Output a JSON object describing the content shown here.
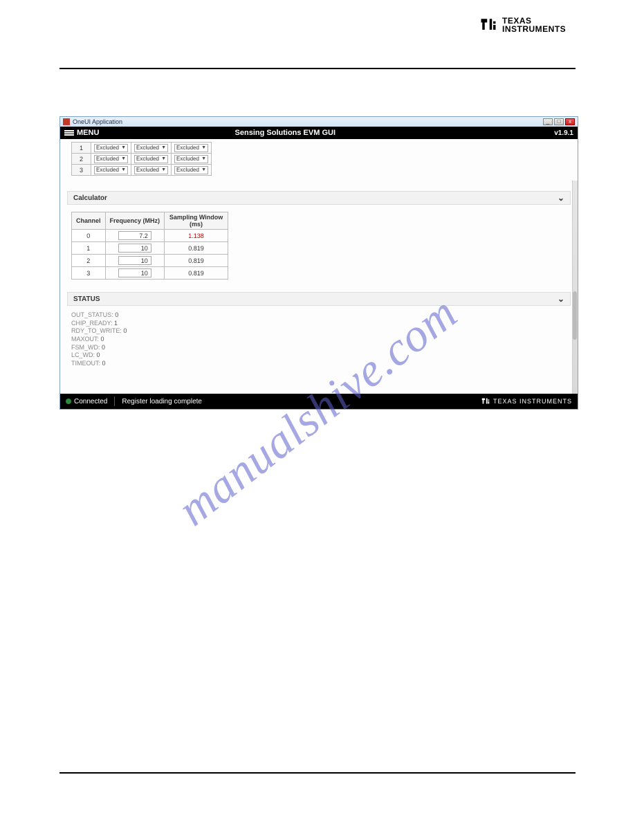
{
  "brand": {
    "name1": "TEXAS",
    "name2": "INSTRUMENTS"
  },
  "window": {
    "title": "OneUI Application",
    "min": "_",
    "max": "□",
    "close": "x"
  },
  "menubar": {
    "menu_label": "MENU",
    "app_title": "Sensing Solutions EVM GUI",
    "version": "v1.9.1"
  },
  "excluded": {
    "rows": [
      {
        "ch": "1",
        "a": "Excluded",
        "b": "Excluded",
        "c": "Excluded"
      },
      {
        "ch": "2",
        "a": "Excluded",
        "b": "Excluded",
        "c": "Excluded"
      },
      {
        "ch": "3",
        "a": "Excluded",
        "b": "Excluded",
        "c": "Excluded"
      }
    ]
  },
  "calculator": {
    "title": "Calculator",
    "headers": {
      "ch": "Channel",
      "freq": "Frequency (MHz)",
      "sw": "Sampling Window (ms)"
    },
    "rows": [
      {
        "ch": "0",
        "freq": "7.2",
        "sw": "1.138",
        "bad": true
      },
      {
        "ch": "1",
        "freq": "10",
        "sw": "0.819"
      },
      {
        "ch": "2",
        "freq": "10",
        "sw": "0.819"
      },
      {
        "ch": "3",
        "freq": "10",
        "sw": "0.819"
      }
    ]
  },
  "status": {
    "title": "STATUS",
    "items": [
      {
        "k": "OUT_STATUS:",
        "v": "0"
      },
      {
        "k": "CHIP_READY:",
        "v": "1"
      },
      {
        "k": "RDY_TO_WRITE:",
        "v": "0"
      },
      {
        "k": "MAXOUT:",
        "v": "0"
      },
      {
        "k": "FSM_WD:",
        "v": "0"
      },
      {
        "k": "LC_WD:",
        "v": "0"
      },
      {
        "k": "TIMEOUT:",
        "v": "0"
      }
    ]
  },
  "footer": {
    "connected": "Connected",
    "message": "Register loading complete",
    "brand": "TEXAS INSTRUMENTS"
  },
  "watermark": "manualshive.com"
}
